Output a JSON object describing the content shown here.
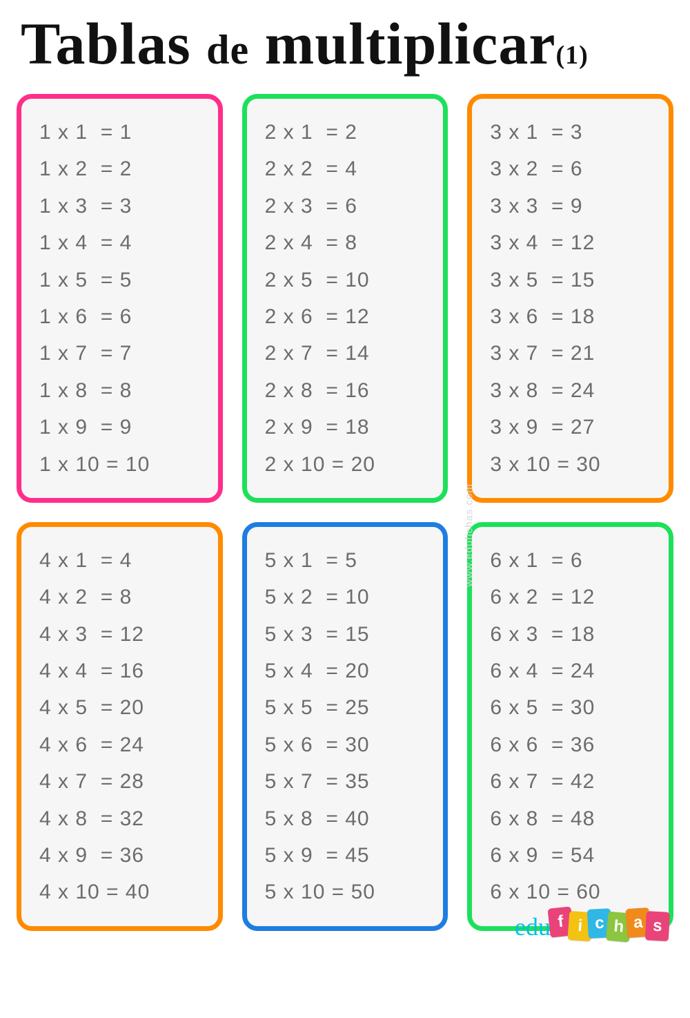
{
  "title": {
    "word1": "Tablas",
    "word2": "de",
    "word3": "multiplicar",
    "suffix": "(1)"
  },
  "watermark": "www.edufichas.com",
  "logo": {
    "prefix": "edu",
    "letters": [
      "f",
      "i",
      "c",
      "h",
      "a",
      "s"
    ]
  },
  "colors": {
    "pink": "#ff2e8b",
    "green": "#1de05a",
    "orange": "#ff8a00",
    "blue": "#1e7de0"
  },
  "tables": [
    {
      "factor": 1,
      "borderColor": "pink",
      "rows": [
        "1 x 1  = 1",
        "1 x 2  = 2",
        "1 x 3  = 3",
        "1 x 4  = 4",
        "1 x 5  = 5",
        "1 x 6  = 6",
        "1 x 7  = 7",
        "1 x 8  = 8",
        "1 x 9  = 9",
        "1 x 10 = 10"
      ]
    },
    {
      "factor": 2,
      "borderColor": "green",
      "rows": [
        "2 x 1  = 2",
        "2 x 2  = 4",
        "2 x 3  = 6",
        "2 x 4  = 8",
        "2 x 5  = 10",
        "2 x 6  = 12",
        "2 x 7  = 14",
        "2 x 8  = 16",
        "2 x 9  = 18",
        "2 x 10 = 20"
      ]
    },
    {
      "factor": 3,
      "borderColor": "orange",
      "rows": [
        "3 x 1  = 3",
        "3 x 2  = 6",
        "3 x 3  = 9",
        "3 x 4  = 12",
        "3 x 5  = 15",
        "3 x 6  = 18",
        "3 x 7  = 21",
        "3 x 8  = 24",
        "3 x 9  = 27",
        "3 x 10 = 30"
      ]
    },
    {
      "factor": 4,
      "borderColor": "orange",
      "rows": [
        "4 x 1  = 4",
        "4 x 2  = 8",
        "4 x 3  = 12",
        "4 x 4  = 16",
        "4 x 5  = 20",
        "4 x 6  = 24",
        "4 x 7  = 28",
        "4 x 8  = 32",
        "4 x 9  = 36",
        "4 x 10 = 40"
      ]
    },
    {
      "factor": 5,
      "borderColor": "blue",
      "rows": [
        "5 x 1  = 5",
        "5 x 2  = 10",
        "5 x 3  = 15",
        "5 x 4  = 20",
        "5 x 5  = 25",
        "5 x 6  = 30",
        "5 x 7  = 35",
        "5 x 8  = 40",
        "5 x 9  = 45",
        "5 x 10 = 50"
      ]
    },
    {
      "factor": 6,
      "borderColor": "green",
      "rows": [
        "6 x 1  = 6",
        "6 x 2  = 12",
        "6 x 3  = 18",
        "6 x 4  = 24",
        "6 x 5  = 30",
        "6 x 6  = 36",
        "6 x 7  = 42",
        "6 x 8  = 48",
        "6 x 9  = 54",
        "6 x 10 = 60"
      ]
    }
  ]
}
